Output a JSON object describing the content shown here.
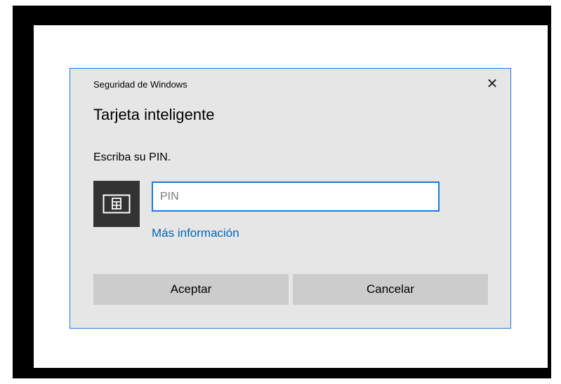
{
  "dialog": {
    "app_title": "Seguridad de Windows",
    "close_glyph": "✕",
    "heading": "Tarjeta inteligente",
    "prompt": "Escriba su PIN.",
    "card_icon": "smart-card-icon",
    "pin": {
      "value": "",
      "placeholder": "PIN"
    },
    "more_info_link": "Más información",
    "buttons": {
      "ok_label": "Aceptar",
      "cancel_label": "Cancelar"
    }
  },
  "colors": {
    "accent": "#1f79d4",
    "link": "#0067c0",
    "dialog_bg": "#e6e6e6",
    "button_bg": "#cccccc",
    "tile_bg": "#333333"
  }
}
